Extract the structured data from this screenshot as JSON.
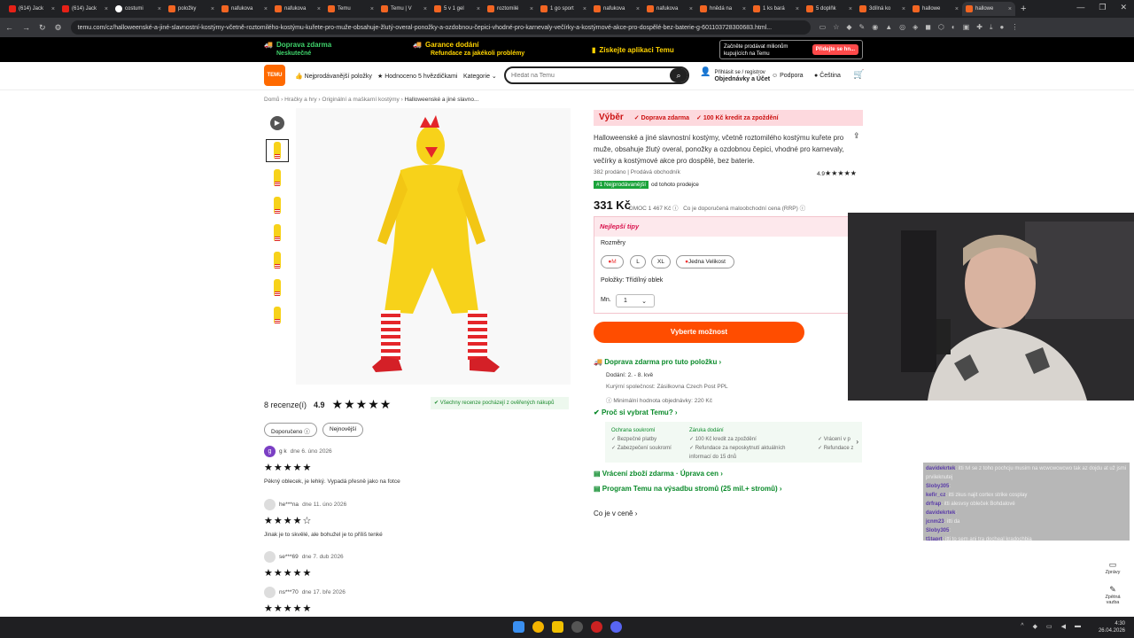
{
  "tabs": [
    {
      "label": "(614) Jack",
      "icon": "youtube-icon"
    },
    {
      "label": "(614) Jack",
      "icon": "youtube-icon"
    },
    {
      "label": "costumi",
      "icon": "google-icon"
    },
    {
      "label": "položky",
      "icon": "temu-icon"
    },
    {
      "label": "nafukova",
      "icon": "temu-icon"
    },
    {
      "label": "nafukova",
      "icon": "temu-icon"
    },
    {
      "label": "Temu",
      "icon": "temu-icon"
    },
    {
      "label": "Temu | V",
      "icon": "temu-icon"
    },
    {
      "label": "5 v 1 gel",
      "icon": "temu-icon"
    },
    {
      "label": "roztomilé",
      "icon": "temu-icon"
    },
    {
      "label": "1 go sport",
      "icon": "temu-icon"
    },
    {
      "label": "nafukova",
      "icon": "temu-icon"
    },
    {
      "label": "nafukova",
      "icon": "temu-icon"
    },
    {
      "label": "hnědá na",
      "icon": "temu-icon"
    },
    {
      "label": "1 ks bará",
      "icon": "temu-icon"
    },
    {
      "label": "5 doplňk",
      "icon": "temu-icon"
    },
    {
      "label": "3dílná ko",
      "icon": "temu-icon"
    },
    {
      "label": "hallowe",
      "icon": "temu-icon"
    },
    {
      "label": "hallowe",
      "icon": "temu-icon"
    }
  ],
  "url": "temu.com/cz/halloweenské-a-jiné-slavnostní-kostýmy-včetně-roztomilého-kostýmu-kuřete-pro-muže-obsahuje-žlutý-overal-ponožky-a-ozdobnou-čepici-vhodné-pro-karnevaly-večírky-a-kostýmové-akce-pro-dospělé-bez-baterie-g-601103728300683.html...",
  "promo": {
    "free_shipping_title": "Doprava zdarma",
    "free_shipping_sub": "Neskutečné",
    "delivery_title": "Garance dodání",
    "delivery_sub": "Refundace za jakékoli problémy",
    "app": "Získejte aplikaci Temu",
    "sell_text": "Začněte prodávat milionům kupujících na Temu",
    "sell_btn": "Přidejte se hn..."
  },
  "header": {
    "logo": "TEMU",
    "bestsellers": "Nejprodávanější položky",
    "rated": "Hodnoceno 5 hvězdičkami",
    "categories": "Kategorie",
    "search_placeholder": "Hledat na Temu",
    "login_top": "Přihlásit se / registrov",
    "login_bottom": "Objednávky a Účet",
    "support": "Podpora",
    "language": "Čeština"
  },
  "breadcrumb": [
    "Domů",
    "Hračky a hry",
    "Originální a maškarní kostýmy",
    "Halloweenské a jiné slavno..."
  ],
  "reviews": {
    "count": "8 recenze(í)",
    "rating": "4.9",
    "verified": "Všechny recenze pocházejí z ověřených nákupů",
    "filter_recommended": "Doporučeno",
    "filter_newest": "Nejnovější",
    "items": [
      {
        "name": "g k",
        "date": "dne 6. úno 2026",
        "stars": "★★★★★",
        "text": "Pěkný oblecek, je lehký. Vypadá přesně jako na fotce"
      },
      {
        "name": "he***na",
        "date": "dne 11. úno 2026",
        "stars": "★★★★☆",
        "text": "Jinak je to skvělé, ale bohužel je to příliš tenké"
      },
      {
        "name": "se***69",
        "date": "dne 7. dub 2026",
        "stars": "★★★★★",
        "text": ""
      },
      {
        "name": "ns***70",
        "date": "dne 17. bře 2026",
        "stars": "★★★★★",
        "text": ""
      }
    ]
  },
  "product": {
    "badge": "Výběr",
    "badge_ship": "Doprava zdarma",
    "badge_credit": "100 Kč kredit za zpoždění",
    "title": "Halloweenské a jiné slavnostní kostýmy, včetně roztomilého kostýmu kuřete pro muže, obsahuje žlutý overal, ponožky a ozdobnou čepici, vhodné pro karnevaly, večírky a kostýmové akce pro dospělé, bez baterie.",
    "sold": "382 prodáno | Prodává obchodník",
    "store_rating": "4.9",
    "rank_badge": "#1 Nejprodávanější",
    "rank_text": "od tohoto prodejce",
    "price": "331 Kč",
    "rrp": "DMOC 1 467 Kč",
    "rrp_text": "Co je doporučená maloobchodní cena (RRP)",
    "tips": "Nejlepší tipy",
    "sizes_label": "Rozměry",
    "sizes": [
      "M",
      "L",
      "XL",
      "Jedna Velikost"
    ],
    "items_label": "Položky: Třídílný oblek",
    "qty_label": "Mn.",
    "qty": "1",
    "cta": "Vyberte možnost",
    "ship_title": "Doprava zdarma pro tuto položku",
    "delivery": "Dodání: 2. - 8. kvě",
    "carriers": "Kurýrní společnost: Zásilkovna  Czech Post  PPL",
    "min_value": "Minimální hodnota objednávky: 220 Kč",
    "why_title": "Proč si vybrat Temu?",
    "why_privacy": "Ochrana soukromí",
    "why_privacy_1": "Bezpečné platby",
    "why_privacy_2": "Zabezpečení soukromí",
    "why_delivery": "Záruka dodání",
    "why_delivery_1": "100 Kč kredit za zpoždění",
    "why_delivery_2": "Refundace za neposkytnutí aktuálních informací do 15 dnů",
    "why_more_1": "Vrácení v p",
    "why_more_2": "Refundace z",
    "returns": "Vrácení zboží zdarma · Úprava cen",
    "trees": "Program Temu na výsadbu stromů (25 mil.+ stromů)",
    "price_info": "Co je v ceně"
  },
  "chat": [
    {
      "user": "davidekrtek",
      "msg": "itti tvl se z toho pochcju musim na wcwcwcwcwo tak az dojdu at už jsmi prvileknutej"
    },
    {
      "user": "Sloby305",
      "msg": ""
    },
    {
      "user": "kefir_cz",
      "msg": "itti zkus najit cortex strike cosplay"
    },
    {
      "user": "drfrap",
      "msg": "itti alesvsy obleček Bohdalové"
    },
    {
      "user": "davidekrtek",
      "msg": ""
    },
    {
      "user": "jcnm23",
      "msg": "itti da"
    },
    {
      "user": "Sloby305",
      "msg": ""
    },
    {
      "user": "t1taprt",
      "msg": "itti to sem ani tra docheal kradochbia"
    }
  ],
  "sidebar": {
    "messages": "Zprávy",
    "feedback": "Zpětná vazba"
  },
  "taskbar": {
    "time": "4:30",
    "date": "26.04.2026"
  }
}
